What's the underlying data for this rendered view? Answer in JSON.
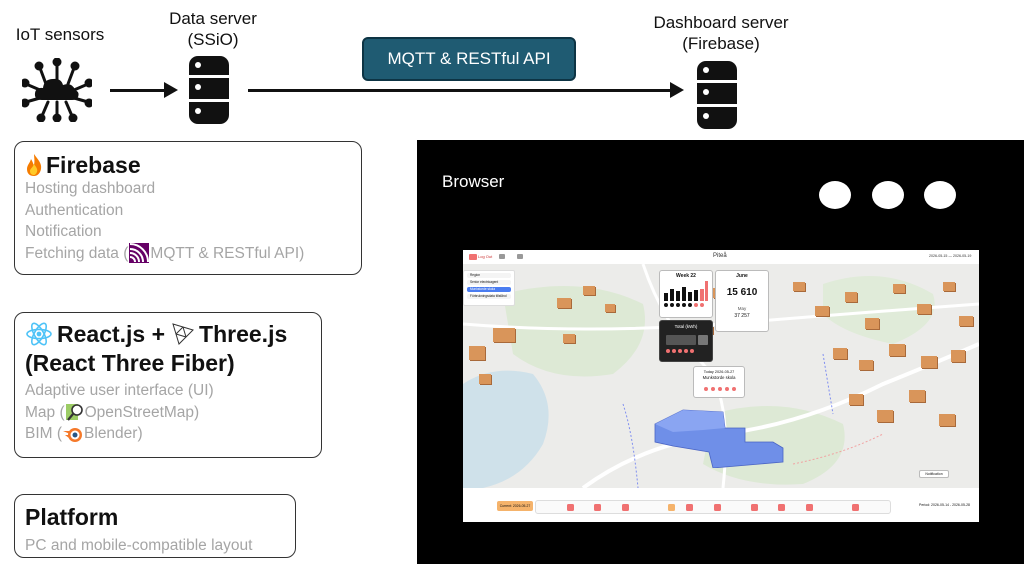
{
  "pipeline": {
    "iot_label": "IoT sensors",
    "data_server_label": "Data server\n(SSiO)",
    "api_label": "MQTT & RESTful API",
    "dashboard_server_label": "Dashboard server\n(Firebase)"
  },
  "firebase_box": {
    "title": "Firebase",
    "lines": [
      "Hosting dashboard",
      "Authentication",
      "Notification"
    ],
    "fetch_prefix": "Fetching data (",
    "fetch_suffix": " MQTT & RESTful API)"
  },
  "react_box": {
    "title_left": "React.js +",
    "title_right": "Three.js",
    "subtitle": "(React Three Fiber)",
    "line_ui": "Adaptive user interface (UI)",
    "map_prefix": "Map (",
    "map_suffix": " OpenStreetMap)",
    "bim_prefix": "BIM (",
    "bim_suffix": " Blender)"
  },
  "platform_box": {
    "title": "Platform",
    "line": "PC and mobile-compatible layout"
  },
  "browser": {
    "title": "Browser",
    "screenshot": {
      "top_left": "Log Out",
      "top_mid": "Piteå",
      "top_right": "2026-05-15 — 2026-05-19",
      "week_title": "Week 22",
      "month_title": "June",
      "month_value": "15 610",
      "month_sub": "May",
      "month_delta": "37 257",
      "total_label": "Total (kWh)",
      "today_title": "Today 2026-05-27",
      "today_sub": "Munkstorde skola",
      "current_label": "Current: 2026-05-27",
      "period_label": "Period: 2026-05-14 - 2026-05-28",
      "notification_label": "Notification",
      "side_items": [
        "Region",
        "Senior electricagent",
        "Munkstorde skola",
        "Förbrukningsdata tillstånd"
      ]
    }
  },
  "colors": {
    "api_fill": "#1f5b72",
    "box_text_grey": "#a5a5a5",
    "browser_bg": "#000000",
    "building": "#d9955a",
    "selected_building": "#6f8fe8",
    "highlight_red": "#f07171"
  }
}
